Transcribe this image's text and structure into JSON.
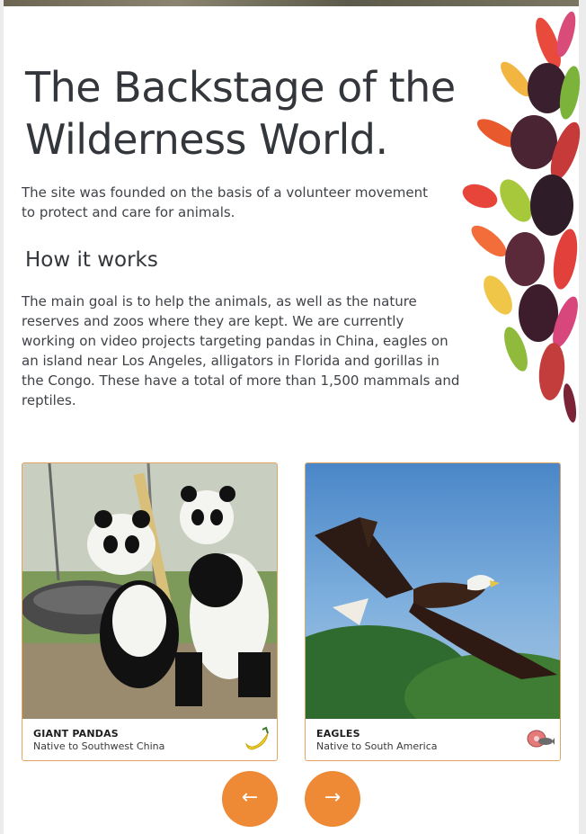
{
  "hero": {
    "title": "The Backstage of the Wilderness World.",
    "intro": "The site was founded on the basis of a volunteer movement to protect and care for animals."
  },
  "how_it_works": {
    "heading": "How it works",
    "body": "The main goal is to help the animals, as well as the nature reserves and zoos where they are kept. We are currently working on video projects targeting pandas in China, eagles on an island near Los Angeles, alligators in Florida and gorillas in the Congo. These have a total of more than 1,500 mammals and reptiles."
  },
  "cards": [
    {
      "name": "GIANT PANDAS",
      "origin": "Native to Southwest China",
      "icon": "banana-icon"
    },
    {
      "name": "EAGLES",
      "origin": "Native to South America",
      "icon": "meat-fish-icon"
    }
  ],
  "carousel": {
    "prev": "←",
    "next": "→"
  },
  "colors": {
    "accent": "#ee8a36",
    "card_border": "#e3a461",
    "text": "#3a3d42"
  }
}
